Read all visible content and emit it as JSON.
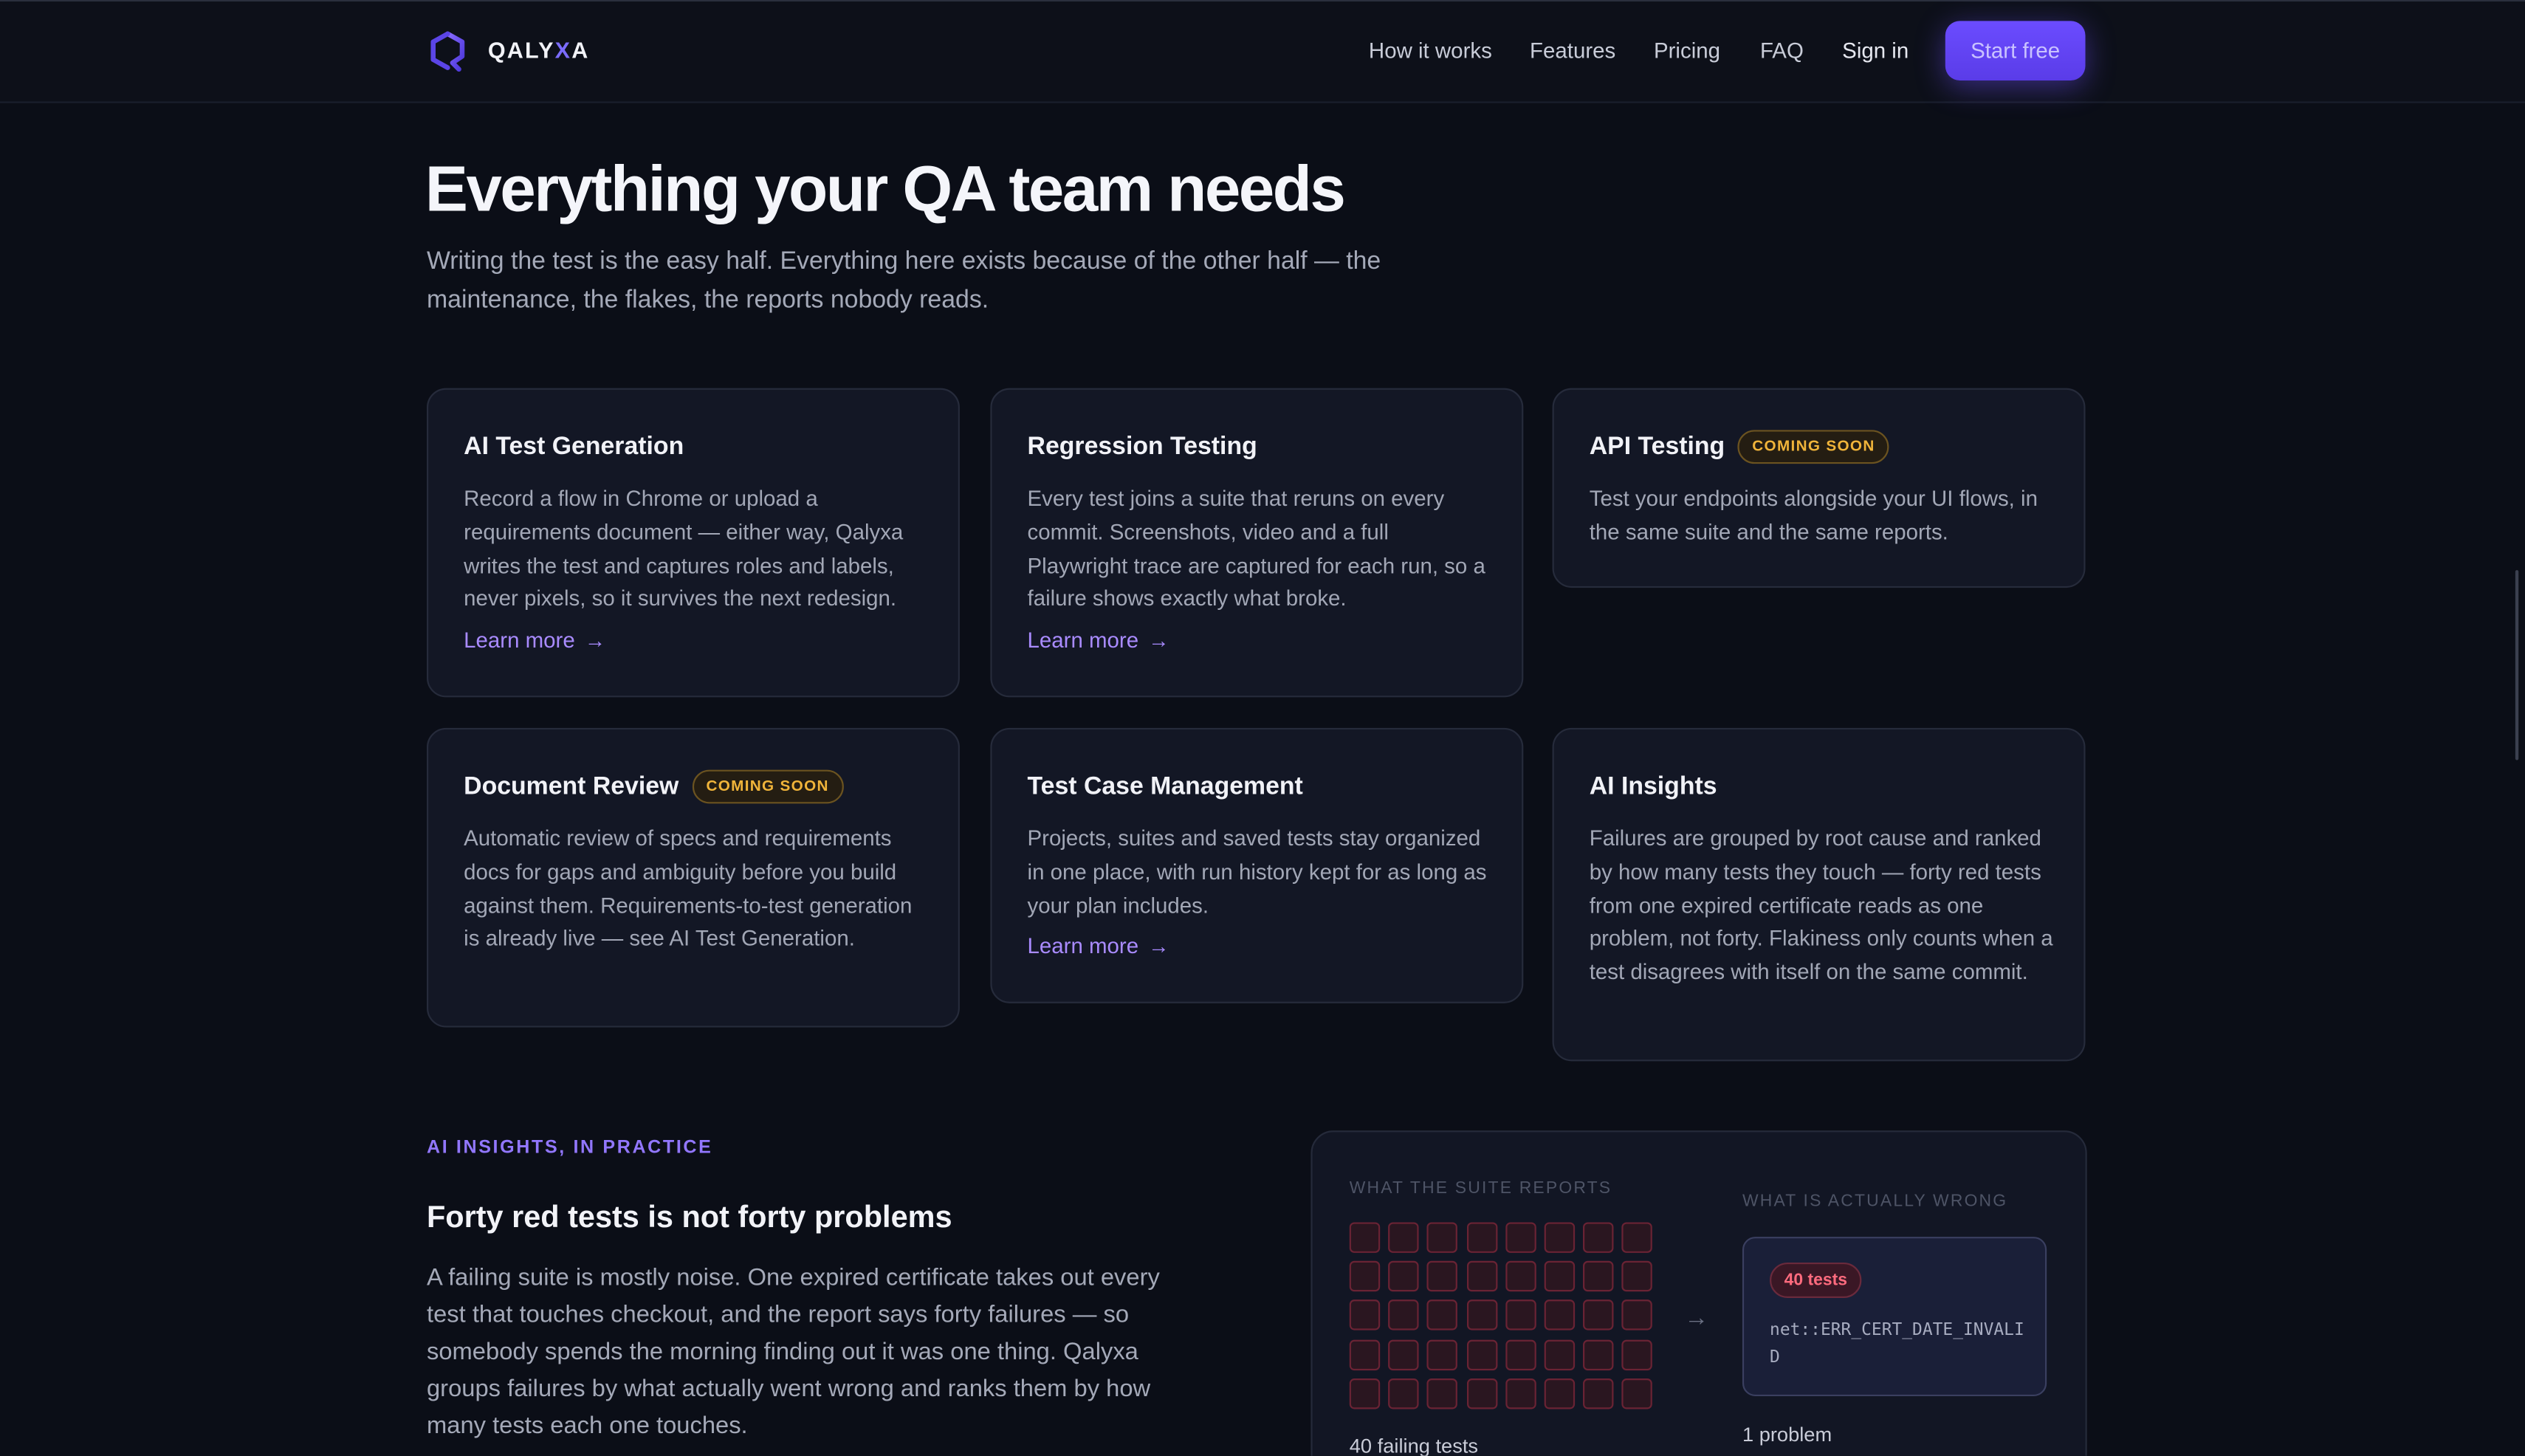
{
  "brand": {
    "prefix": "QALY",
    "x": "X",
    "suffix": "A"
  },
  "nav": {
    "how": "How it works",
    "features": "Features",
    "pricing": "Pricing",
    "faq": "FAQ",
    "signin": "Sign in",
    "cta": "Start free"
  },
  "hero": {
    "title": "Everything your QA team needs",
    "subtitle": "Writing the test is the easy half. Everything here exists because of the other half — the maintenance, the flakes, the reports nobody reads."
  },
  "cards": [
    {
      "title": "AI Test Generation",
      "badge": "",
      "desc": "Record a flow in Chrome or upload a requirements document — either way, Qalyxa writes the test and captures roles and labels, never pixels, so it survives the next redesign.",
      "link": "Learn more"
    },
    {
      "title": "Regression Testing",
      "badge": "",
      "desc": "Every test joins a suite that reruns on every commit. Screenshots, video and a full Playwright trace are captured for each run, so a failure shows exactly what broke.",
      "link": "Learn more"
    },
    {
      "title": "API Testing",
      "badge": "COMING SOON",
      "desc": "Test your endpoints alongside your UI flows, in the same suite and the same reports.",
      "link": ""
    },
    {
      "title": "Document Review",
      "badge": "COMING SOON",
      "desc": "Automatic review of specs and requirements docs for gaps and ambiguity before you build against them. Requirements-to-test generation is already live — see AI Test Generation.",
      "link": ""
    },
    {
      "title": "Test Case Management",
      "badge": "",
      "desc": "Projects, suites and saved tests stay organized in one place, with run history kept for as long as your plan includes.",
      "link": "Learn more"
    },
    {
      "title": "AI Insights",
      "badge": "",
      "desc": "Failures are grouped by root cause and ranked by how many tests they touch — forty red tests from one expired certificate reads as one problem, not forty. Flakiness only counts when a test disagrees with itself on the same commit.",
      "link": ""
    }
  ],
  "insights": {
    "eyebrow": "AI INSIGHTS, IN PRACTICE",
    "title": "Forty red tests is not forty problems",
    "paragraph": "A failing suite is mostly noise. One expired certificate takes out every test that touches checkout, and the report says forty failures — so somebody spends the morning finding out it was one thing. Qalyxa groups failures by what actually went wrong and ranks them by how many tests each one touches.",
    "left_label": "WHAT THE SUITE REPORTS",
    "right_label": "WHAT IS ACTUALLY WRONG",
    "failing_count": 40,
    "left_footer": "40 failing tests",
    "badge": "40 tests",
    "error_code": "net::ERR_CERT_DATE_INVALID",
    "right_footer": "1 problem"
  },
  "icons": {
    "logo": "qalyxa-logo-icon",
    "arrow": "arrow-right-icon"
  },
  "colors": {
    "background": "#0b0e17",
    "accent": "#7b6cff",
    "link": "#a98bff",
    "badge": "#f0b43a",
    "error": "#ff6b7e"
  }
}
